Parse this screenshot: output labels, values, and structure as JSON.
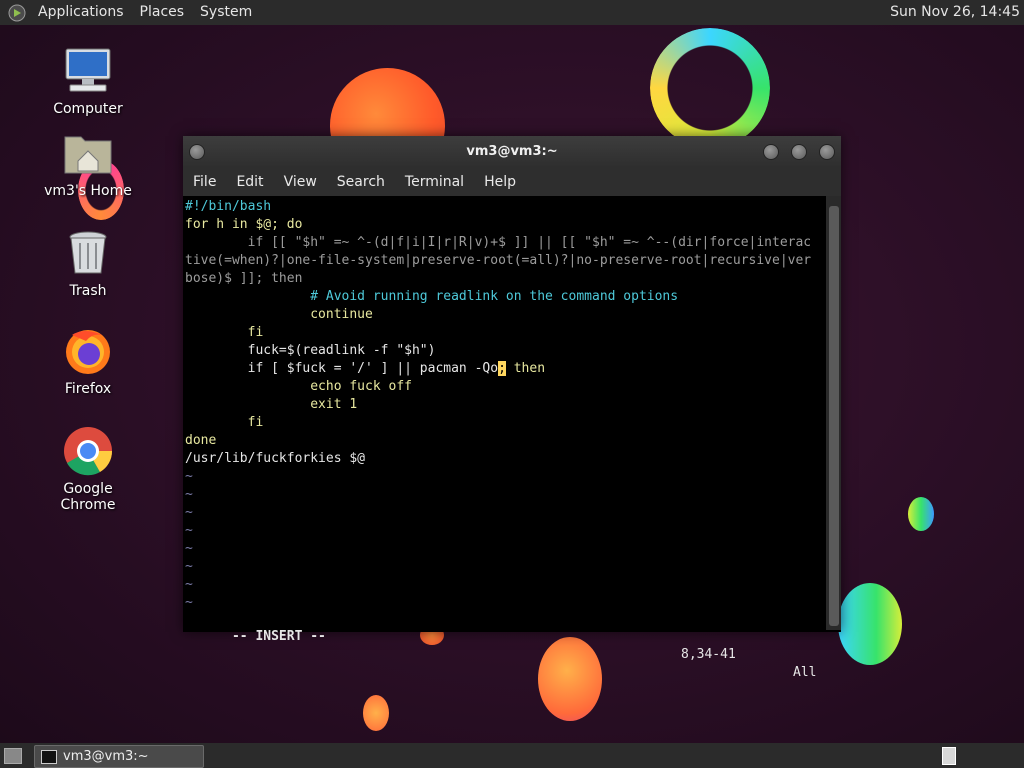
{
  "top_panel": {
    "menus": [
      "Applications",
      "Places",
      "System"
    ],
    "clock": "Sun Nov 26, 14:45",
    "logo_icon": "gnome-foot-icon"
  },
  "desktop_icons": [
    {
      "label": "Computer",
      "icon": "computer-icon"
    },
    {
      "label": "vm3's Home",
      "icon": "home-folder-icon"
    },
    {
      "label": "Trash",
      "icon": "trash-icon"
    },
    {
      "label": "Firefox",
      "icon": "firefox-icon"
    },
    {
      "label": "Google Chrome",
      "icon": "chrome-icon"
    }
  ],
  "terminal": {
    "title": "vm3@vm3:~",
    "menu": [
      "File",
      "Edit",
      "View",
      "Search",
      "Terminal",
      "Help"
    ],
    "lines": [
      "#!/bin/bash",
      "for h in $@; do",
      "        if [[ \"$h\" =~ ^-(d|f|i|I|r|R|v)+$ ]] || [[ \"$h\" =~ ^--(dir|force|interac",
      "tive(=when)?|one-file-system|preserve-root(=all)?|no-preserve-root|recursive|ver",
      "bose)$ ]]; then",
      "                # Avoid running readlink on the command options",
      "                continue",
      "        fi",
      "        fuck=$(readlink -f \"$h\")",
      "        if [ $fuck = '/' ] || pacman -Qo",
      "                echo fuck off",
      "                exit 1",
      "        fi",
      "done",
      "/usr/lib/fuckforkies $@"
    ],
    "cursor_char": ";",
    "after_cursor": " then",
    "tilde_lines": [
      "~",
      "~",
      "~",
      "~",
      "~",
      "~",
      "~",
      "~"
    ],
    "status_mode": "-- INSERT --",
    "status_pos": "8,34-41",
    "status_scroll": "All"
  },
  "taskbar": {
    "window_button": "vm3@vm3:~"
  },
  "colors": {
    "panel": "#2b2b2b",
    "keyword": "#e8e8a0",
    "variable": "#4ec9d9",
    "cursor": "#ffd75f"
  }
}
